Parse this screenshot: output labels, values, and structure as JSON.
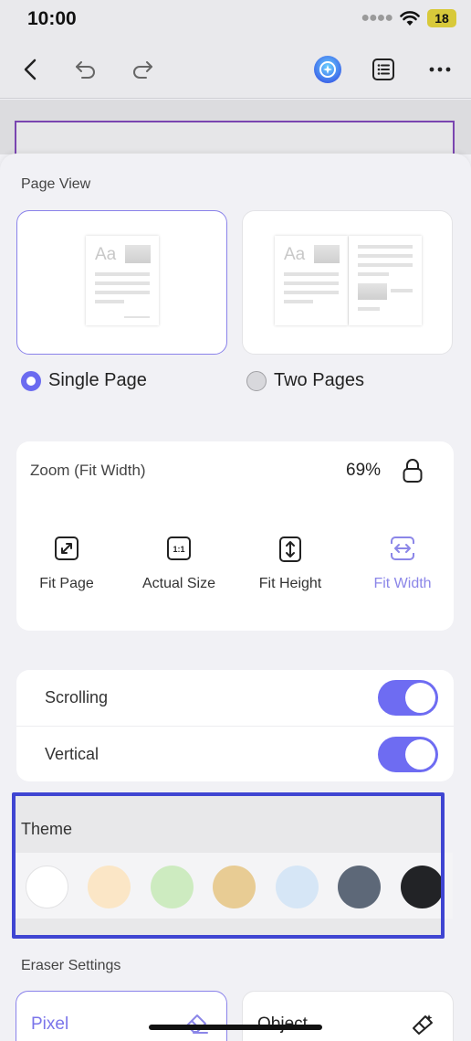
{
  "status": {
    "time": "10:00",
    "battery": "18"
  },
  "toolbar": {
    "back_icon": "chevron-left-icon",
    "undo_icon": "undo-icon",
    "redo_icon": "redo-icon",
    "ai_icon": "ai-assistant-icon",
    "outline_icon": "list-icon",
    "more_icon": "more-icon"
  },
  "page_view": {
    "title": "Page View",
    "thumb_text": "Aa",
    "options": [
      {
        "label": "Single Page",
        "selected": true
      },
      {
        "label": "Two Pages",
        "selected": false
      }
    ]
  },
  "zoom": {
    "title": "Zoom (Fit Width)",
    "value": "69%",
    "options": [
      {
        "label": "Fit Page",
        "icon": "expand-icon",
        "active": false
      },
      {
        "label": "Actual Size",
        "icon": "one-to-one-icon",
        "active": false
      },
      {
        "label": "Fit Height",
        "icon": "fit-height-icon",
        "active": false
      },
      {
        "label": "Fit Width",
        "icon": "fit-width-icon",
        "active": true
      }
    ],
    "actual_size_glyph": "1:1"
  },
  "toggles": [
    {
      "label": "Scrolling",
      "on": true
    },
    {
      "label": "Vertical",
      "on": true
    }
  ],
  "theme": {
    "title": "Theme",
    "swatches": [
      "#ffffff",
      "#fbe6c6",
      "#cdebc0",
      "#e8cc94",
      "#d6e6f6",
      "#5d6878",
      "#222326"
    ]
  },
  "eraser": {
    "title": "Eraser Settings",
    "options": [
      {
        "label": "Pixel",
        "selected": true,
        "icon": "eraser-icon"
      },
      {
        "label": "Object",
        "selected": false,
        "icon": "object-eraser-icon"
      }
    ]
  },
  "colors": {
    "accent": "#6e6cf2",
    "highlight": "#3f45d2"
  }
}
